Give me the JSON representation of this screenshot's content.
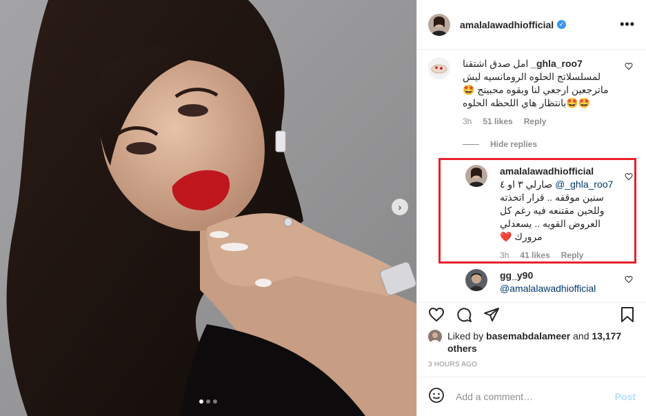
{
  "post": {
    "author": "amalalawadhiofficial",
    "verified_icon": "verified-badge-icon",
    "more_icon": "more-options-icon",
    "carousel": {
      "current": 1,
      "total": 3
    }
  },
  "comments": [
    {
      "user": "_ghla_roo7",
      "text": "امل صدق اشتقنا لمسلسلاتج الحلوه الرومانسيه ليش ماترجعين ارجعي لنا وبقوه محبينج 🤩🤩🤩بانتظار هاي اللحظه الحلوه",
      "time": "3h",
      "likes": "51 likes",
      "reply": "Reply"
    }
  ],
  "hide_replies": "Hide replies",
  "replies": [
    {
      "user": "amalalawadhiofficial",
      "mention": "@_ghla_roo7",
      "text": "صارلي ٣ او ٤ سنين موقفه .. قرار اتخذته وللحين مقتنعه فيه رغم كل العروض القويه .. يسعدلي مرورك",
      "heart": "❤️",
      "time": "3h",
      "likes": "41 likes",
      "reply": "Reply"
    },
    {
      "user": "gg_y90",
      "mention": "@amalalawadhiofficial"
    }
  ],
  "liked_by": {
    "prefix": "Liked by",
    "user": "basemabdalameer",
    "and": "and",
    "others": "13,177 others"
  },
  "timestamp": "3 HOURS AGO",
  "add_comment": {
    "placeholder": "Add a comment…",
    "post_label": "Post"
  },
  "colors": {
    "highlight": "#e8202a",
    "verified": "#3897f0",
    "post_button": "#b2dffc"
  }
}
